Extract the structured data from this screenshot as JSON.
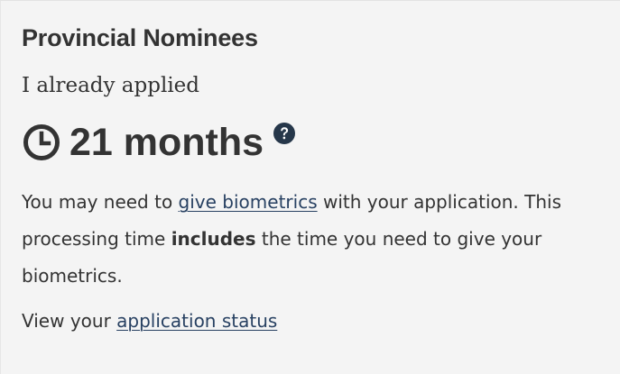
{
  "panel": {
    "title": "Provincial Nominees",
    "status_label": "I already applied",
    "processing_time": "21 months",
    "biometrics": {
      "before_link": "You may need to ",
      "link_text": "give biometrics",
      "after_link": " with your application. This processing time ",
      "emphasis": "includes",
      "end": " the time you need to give your biometrics."
    },
    "status": {
      "prefix": "View your ",
      "link_text": "application status"
    }
  },
  "icons": {
    "clock": "clock-icon",
    "help": "question-circle-icon"
  },
  "colors": {
    "text": "#333333",
    "link": "#284162",
    "help_icon": "#26374a",
    "background": "#f4f4f4"
  }
}
